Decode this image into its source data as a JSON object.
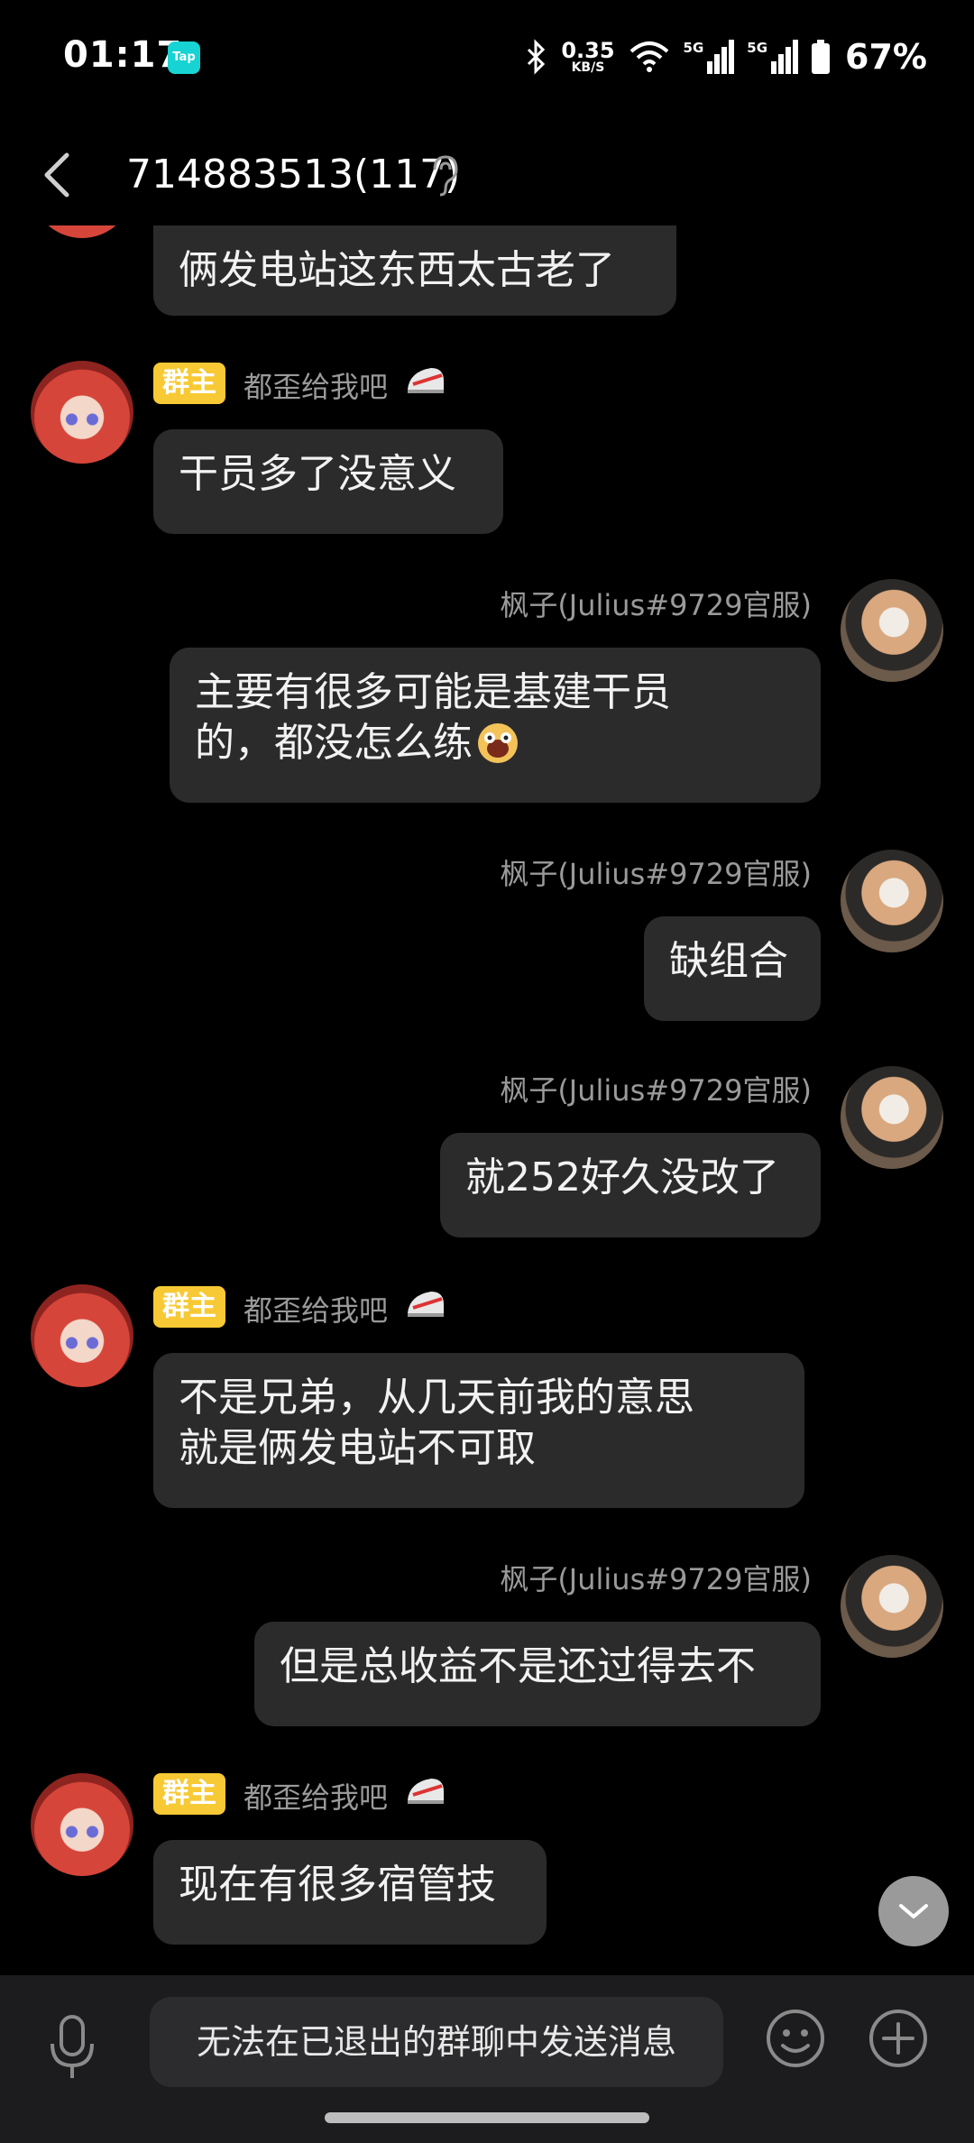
{
  "status_bar": {
    "time": "01:17",
    "app_icon": "Tap",
    "net_speed_value": "0.35",
    "net_speed_unit": "KB/S",
    "sig1_label": "5G",
    "sig2_label": "5G",
    "battery": "67%"
  },
  "header": {
    "title": "714883513(117)"
  },
  "messages": [
    {
      "text": "俩发电站这东西太古老了"
    },
    {
      "badge": "群主",
      "name": "都歪给我吧",
      "text": "干员多了没意义"
    },
    {
      "name": "枫子(Julius#9729官服)",
      "text_line1": "主要有很多可能是基建干员",
      "text_line2": "的，都没怎么练"
    },
    {
      "name": "枫子(Julius#9729官服)",
      "text": "缺组合"
    },
    {
      "name": "枫子(Julius#9729官服)",
      "text": "就252好久没改了"
    },
    {
      "badge": "群主",
      "name": "都歪给我吧",
      "text_line1": "不是兄弟，从几天前我的意思",
      "text_line2": "就是俩发电站不可取"
    },
    {
      "name": "枫子(Julius#9729官服)",
      "text": "但是总收益不是还过得去不"
    },
    {
      "badge": "群主",
      "name": "都歪给我吧",
      "text": "现在有很多宿管技"
    }
  ],
  "bottom": {
    "input_placeholder": "无法在已退出的群聊中发送消息"
  },
  "colors": {
    "background": "#000000",
    "bubble": "#2b2b2b",
    "badge": "#f7c934",
    "name": "#9a9a9a"
  }
}
